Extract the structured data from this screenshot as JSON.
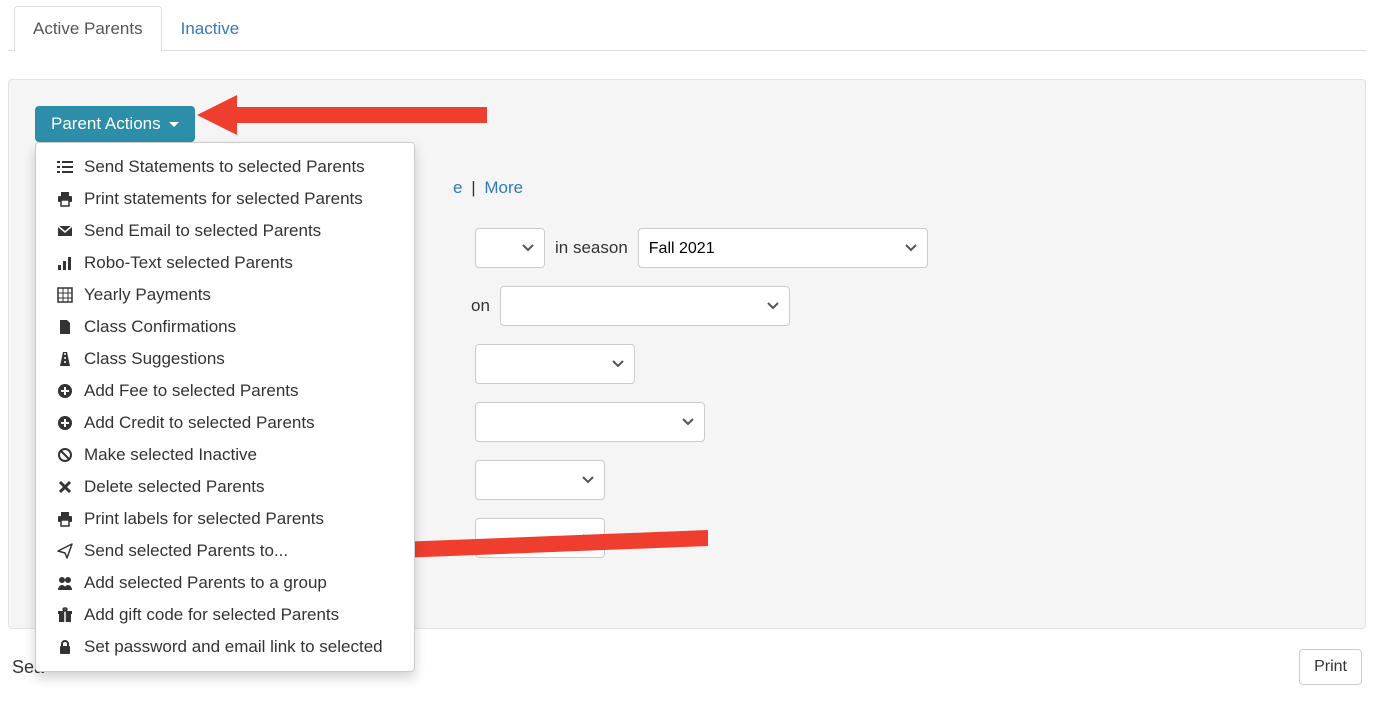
{
  "tabs": {
    "active": "Active Parents",
    "inactive": "Inactive"
  },
  "parent_actions": {
    "button_label": "Parent Actions",
    "items": [
      {
        "icon": "list-icon",
        "label": "Send Statements to selected Parents"
      },
      {
        "icon": "print-icon",
        "label": "Print statements for selected Parents"
      },
      {
        "icon": "mail-icon",
        "label": "Send Email to selected Parents"
      },
      {
        "icon": "signal-icon",
        "label": "Robo-Text selected Parents"
      },
      {
        "icon": "grid-icon",
        "label": "Yearly Payments"
      },
      {
        "icon": "file-icon",
        "label": "Class Confirmations"
      },
      {
        "icon": "road-icon",
        "label": "Class Suggestions"
      },
      {
        "icon": "plus-circle-icon",
        "label": "Add Fee to selected Parents"
      },
      {
        "icon": "plus-circle-icon",
        "label": "Add Credit to selected Parents"
      },
      {
        "icon": "ban-icon",
        "label": "Make selected Inactive"
      },
      {
        "icon": "times-icon",
        "label": "Delete selected Parents"
      },
      {
        "icon": "print-icon",
        "label": "Print labels for selected Parents"
      },
      {
        "icon": "send-icon",
        "label": "Send selected Parents to..."
      },
      {
        "icon": "users-icon",
        "label": "Add selected Parents to a group"
      },
      {
        "icon": "gift-icon",
        "label": "Add gift code for selected Parents"
      },
      {
        "icon": "lock-icon",
        "label": "Set password and email link to selected"
      }
    ]
  },
  "filters": {
    "links": {
      "frag_e": "e",
      "sep": " | ",
      "more": "More"
    },
    "in_season_label": "in season",
    "season_value": "Fall 2021",
    "location_frag": "on"
  },
  "bottom": {
    "search_fragment": "Sea",
    "print_label": "Print"
  }
}
